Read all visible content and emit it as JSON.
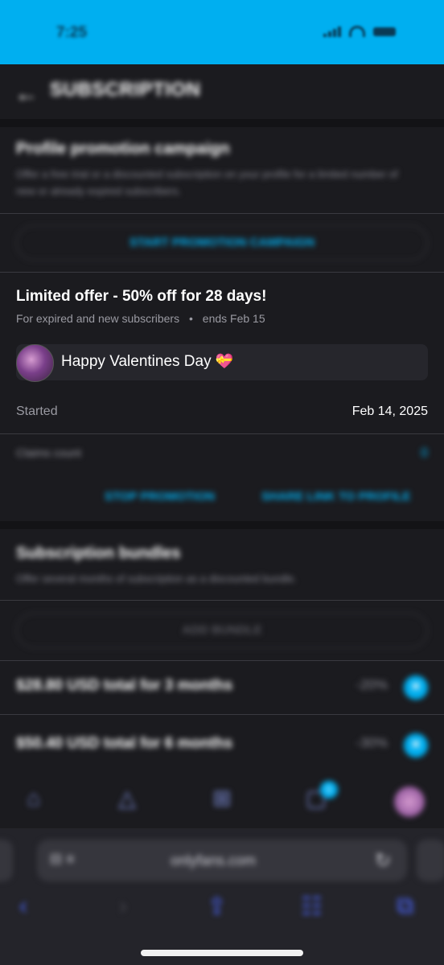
{
  "status_bar": {
    "time": "7:25"
  },
  "header": {
    "title": "SUBSCRIPTION"
  },
  "promotion": {
    "title": "Profile promotion campaign",
    "description": "Offer a free trial or a discounted subscription on your profile for a limited number of new or already expired subscribers.",
    "start_button": "START PROMOTION CAMPAIGN"
  },
  "offer": {
    "title": "Limited offer - 50% off for 28 days!",
    "audience": "For expired and new subscribers",
    "separator": "•",
    "ends": "ends Feb 15",
    "message": "Happy Valentines Day",
    "message_emoji": "💝",
    "started_label": "Started",
    "started_value": "Feb 14, 2025",
    "claims_label": "Claims count",
    "claims_value": "0",
    "stop_button": "STOP PROMOTION",
    "share_button": "SHARE LINK TO PROFILE"
  },
  "bundles": {
    "title": "Subscription bundles",
    "description": "Offer several months of subscription as a discounted bundle.",
    "add_button": "ADD BUNDLE",
    "items": [
      {
        "label": "$28.80 USD total for 3 months",
        "discount": "-20%"
      },
      {
        "label": "$50.40 USD total for 6 months",
        "discount": "-30%"
      }
    ]
  },
  "tabbar": {
    "messages_badge": "5"
  },
  "browser": {
    "url": "onlyfans.com",
    "page_menu": "⊟ ≡"
  },
  "colors": {
    "accent": "#00aff0",
    "background": "#1b1b1f"
  }
}
